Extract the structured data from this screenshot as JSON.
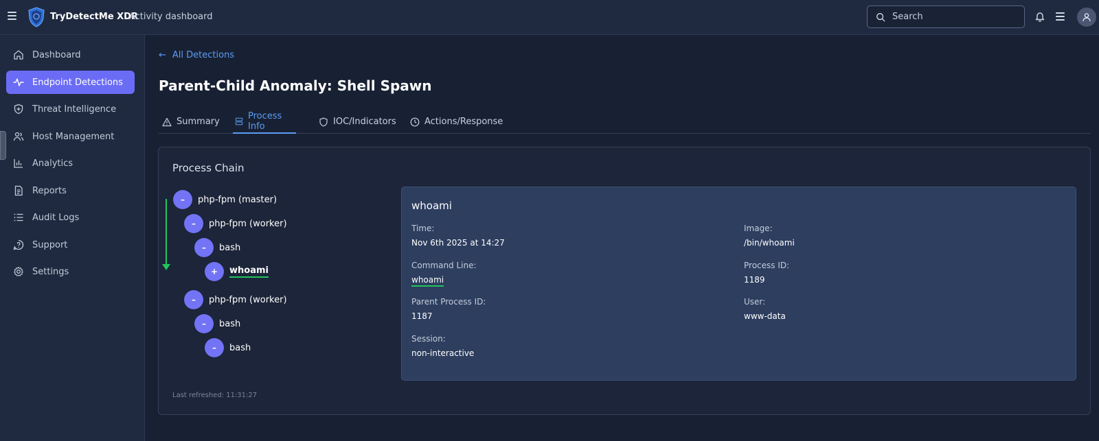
{
  "app": {
    "name": "TryDetectMe XDR",
    "section": "Activity dashboard"
  },
  "search": {
    "placeholder": "Search"
  },
  "sidebar": {
    "items": [
      {
        "label": "Dashboard",
        "icon": "home-icon"
      },
      {
        "label": "Endpoint Detections",
        "icon": "activity-icon",
        "active": true
      },
      {
        "label": "Threat Intelligence",
        "icon": "shield-plus-icon"
      },
      {
        "label": "Host Management",
        "icon": "users-icon"
      },
      {
        "label": "Analytics",
        "icon": "bar-chart-icon"
      },
      {
        "label": "Reports",
        "icon": "file-text-icon"
      },
      {
        "label": "Audit Logs",
        "icon": "list-icon"
      },
      {
        "label": "Support",
        "icon": "help-circle-icon"
      },
      {
        "label": "Settings",
        "icon": "gear-icon"
      }
    ]
  },
  "main": {
    "back_label": "All Detections",
    "title": "Parent-Child Anomaly: Shell Spawn",
    "tabs": [
      {
        "label": "Summary",
        "icon": "alert-triangle-icon"
      },
      {
        "label": "Process Info",
        "icon": "server-icon",
        "active": true
      },
      {
        "label": "IOC/Indicators",
        "icon": "shield-icon"
      },
      {
        "label": "Actions/Response",
        "icon": "clock-icon"
      }
    ]
  },
  "process_chain": {
    "title": "Process Chain",
    "nodes": [
      {
        "label": "php-fpm (master)",
        "toggle": "–"
      },
      {
        "label": "php-fpm (worker)",
        "toggle": "–"
      },
      {
        "label": "bash",
        "toggle": "–"
      },
      {
        "label": "whoami",
        "toggle": "+",
        "selected": true
      },
      {
        "label": "php-fpm (worker)",
        "toggle": "–"
      },
      {
        "label": "bash",
        "toggle": "–"
      },
      {
        "label": "bash",
        "toggle": "–"
      }
    ],
    "last_refreshed": "Last refreshed: 11:31:27"
  },
  "details": {
    "title": "whoami",
    "time_label": "Time:",
    "time_value": "Nov 6th 2025 at 14:27",
    "image_label": "Image:",
    "image_value": "/bin/whoami",
    "cmd_label": "Command Line:",
    "cmd_value": "whoami",
    "pid_label": "Process ID:",
    "pid_value": "1189",
    "ppid_label": "Parent Process ID:",
    "ppid_value": "1187",
    "user_label": "User:",
    "user_value": "www-data",
    "session_label": "Session:",
    "session_value": "non-interactive"
  },
  "colors": {
    "accent": "#6b6cf5",
    "link": "#5b9cf5",
    "highlight": "#22c55e"
  }
}
